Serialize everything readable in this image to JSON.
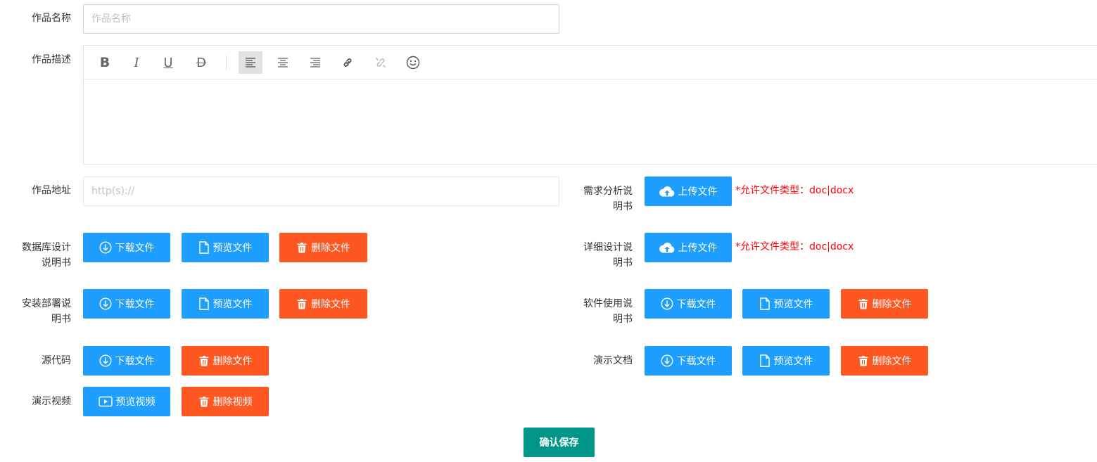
{
  "fields": {
    "name": {
      "label": "作品名称",
      "placeholder": "作品名称",
      "value": ""
    },
    "description": {
      "label": "作品描述"
    },
    "url": {
      "label": "作品地址",
      "placeholder": "http(s)://",
      "value": ""
    },
    "requirements_doc": {
      "label": "需求分析说明书"
    },
    "detail_design_doc": {
      "label": "详细设计说明书"
    },
    "database_design_doc": {
      "label": "数据库设计说明书"
    },
    "install_doc": {
      "label": "安装部署说明书"
    },
    "software_usage_doc": {
      "label": "软件使用说明书"
    },
    "source_code": {
      "label": "源代码"
    },
    "demo_doc": {
      "label": "演示文档"
    },
    "demo_video": {
      "label": "演示视频"
    }
  },
  "editor": {
    "toolbar_icons": [
      "bold-icon",
      "italic-icon",
      "underline-icon",
      "strikethrough-icon",
      "align-left-icon",
      "align-center-icon",
      "align-right-icon",
      "link-icon",
      "unlink-icon",
      "emoji-icon"
    ],
    "glyphs": {
      "bold": "B",
      "italic": "I",
      "underline": "U",
      "strike": "D"
    }
  },
  "buttons": {
    "upload": "上传文件",
    "download": "下载文件",
    "preview": "预览文件",
    "delete": "删除文件",
    "preview_video": "预览视频",
    "delete_video": "删除视频",
    "save": "确认保存"
  },
  "hint": "*允许文件类型：doc|docx",
  "colors": {
    "blue": "#1e9fff",
    "orange": "#ff5722",
    "green": "#009688",
    "hint": "#ff0000"
  }
}
